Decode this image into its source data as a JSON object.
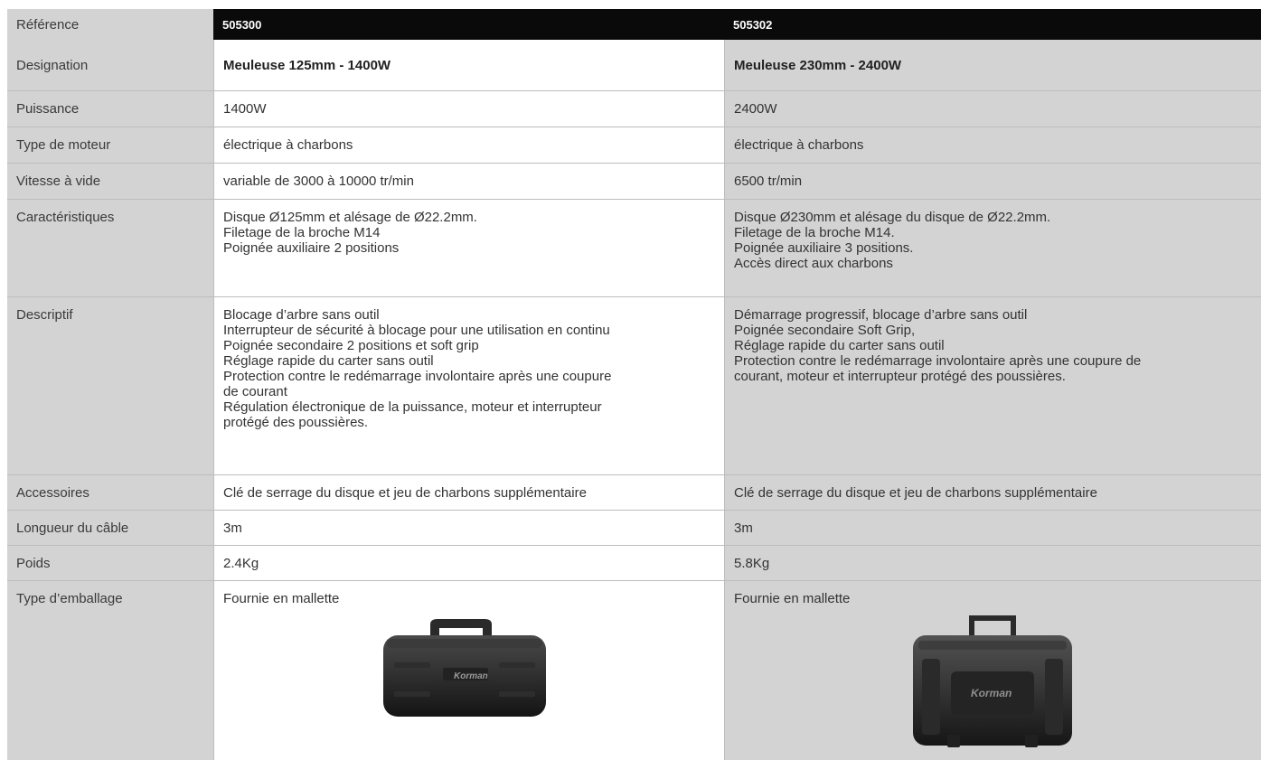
{
  "table": {
    "labels": {
      "reference": "Référence",
      "designation": "Designation",
      "puissance": "Puissance",
      "moteur": "Type de moteur",
      "vitesse": "Vitesse à vide",
      "caracteristiques": "Caractéristiques",
      "descriptif": "Descriptif",
      "accessoires": "Accessoires",
      "cable": "Longueur du câble",
      "poids": "Poids",
      "emballage": "Type d’emballage"
    },
    "products": [
      {
        "reference": "505300",
        "designation": "Meuleuse 125mm - 1400W",
        "puissance": "1400W",
        "moteur": "électrique à charbons",
        "vitesse": "variable de 3000 à 10000 tr/min",
        "caracteristiques": [
          "Disque Ø125mm et alésage de Ø22.2mm.",
          "Filetage de la broche M14",
          "Poignée auxiliaire 2 positions"
        ],
        "descriptif": [
          "Blocage d’arbre sans outil",
          "Interrupteur de sécurité à blocage pour une utilisation en continu",
          "Poignée secondaire 2 positions et soft grip",
          "Réglage rapide du carter sans outil",
          "Protection contre le redémarrage involontaire après une coupure",
          "de courant",
          "Régulation électronique de la puissance, moteur et interrupteur",
          "protégé des poussières."
        ],
        "accessoires": "Clé de serrage du disque et jeu de charbons supplémentaire",
        "cable": "3m",
        "poids": "2.4Kg",
        "emballage": "Fournie en mallette",
        "case_brand": "Korman"
      },
      {
        "reference": "505302",
        "designation": "Meuleuse 230mm - 2400W",
        "puissance": "2400W",
        "moteur": "électrique à charbons",
        "vitesse": "6500 tr/min",
        "caracteristiques": [
          "Disque Ø230mm et alésage du disque de Ø22.2mm.",
          "Filetage de la broche M14.",
          "Poignée auxiliaire 3 positions.",
          "Accès direct aux charbons"
        ],
        "descriptif": [
          "Démarrage progressif, blocage d’arbre sans outil",
          "Poignée secondaire Soft Grip,",
          "Réglage rapide du carter sans outil",
          "Protection contre le redémarrage involontaire après une coupure de",
          "courant, moteur et interrupteur protégé des poussières."
        ],
        "accessoires": "Clé de serrage du disque et jeu de charbons supplémentaire",
        "cable": "3m",
        "poids": "5.8Kg",
        "emballage": "Fournie en mallette",
        "case_brand": "Korman"
      }
    ]
  }
}
